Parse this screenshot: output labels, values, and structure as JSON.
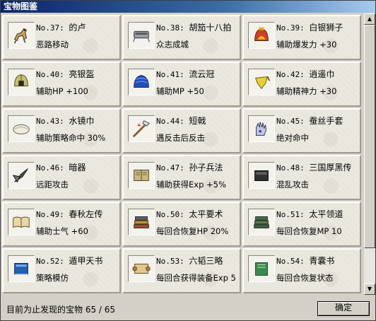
{
  "window": {
    "title": "宝物图鉴"
  },
  "items": [
    {
      "num": "No.37:",
      "name": "的卢",
      "desc": "恶路移动",
      "icon": "horse-icon"
    },
    {
      "num": "No.38:",
      "name": "胡笳十八拍",
      "desc": "众志成城",
      "icon": "instrument-icon"
    },
    {
      "num": "No.39:",
      "name": "白银狮子",
      "desc": "辅助爆发力 +30",
      "icon": "lion-helmet-icon"
    },
    {
      "num": "No.40:",
      "name": "亮银盔",
      "desc": "辅助HP +100",
      "icon": "silver-helmet-icon"
    },
    {
      "num": "No.41:",
      "name": "流云冠",
      "desc": "辅助MP +50",
      "icon": "blue-crown-icon"
    },
    {
      "num": "No.42:",
      "name": "逍遥巾",
      "desc": "辅助精神力 +30",
      "icon": "headscarf-icon"
    },
    {
      "num": "No.43:",
      "name": "水镜巾",
      "desc": "辅助策略命中 30%",
      "icon": "white-scarf-icon"
    },
    {
      "num": "No.44:",
      "name": "短戟",
      "desc": "遇反击后反击",
      "icon": "halberd-icon"
    },
    {
      "num": "No.45:",
      "name": "蚕丝手套",
      "desc": "绝对命中",
      "icon": "glove-icon"
    },
    {
      "num": "No.46:",
      "name": "暗器",
      "desc": "远距攻击",
      "icon": "dart-icon"
    },
    {
      "num": "No.47:",
      "name": "孙子兵法",
      "desc": "辅助获得Exp +5%",
      "icon": "book-icon"
    },
    {
      "num": "No.48:",
      "name": "三国厚黑传",
      "desc": "混乱攻击",
      "icon": "dark-book-icon"
    },
    {
      "num": "No.49:",
      "name": "春秋左传",
      "desc": "辅助士气 +60",
      "icon": "open-book-icon"
    },
    {
      "num": "No.50:",
      "name": "太平要术",
      "desc": "每回合恢复HP 20%",
      "icon": "book-stack-icon"
    },
    {
      "num": "No.51:",
      "name": "太平领道",
      "desc": "每回合恢复MP 10",
      "icon": "green-books-icon"
    },
    {
      "num": "No.52:",
      "name": "遁甲天书",
      "desc": "策略模仿",
      "icon": "blue-book-icon"
    },
    {
      "num": "No.53:",
      "name": "六韬三略",
      "desc": "每回合获得装备Exp 5",
      "icon": "scroll-icon"
    },
    {
      "num": "No.54:",
      "name": "青囊书",
      "desc": "每回合恢复状态",
      "icon": "green-book-icon"
    }
  ],
  "status": {
    "text": "目前为止发现的宝物 65 / 65"
  },
  "ok_button": {
    "label": "确定"
  },
  "scrollbar": {
    "up": "▲",
    "down": "▼"
  }
}
